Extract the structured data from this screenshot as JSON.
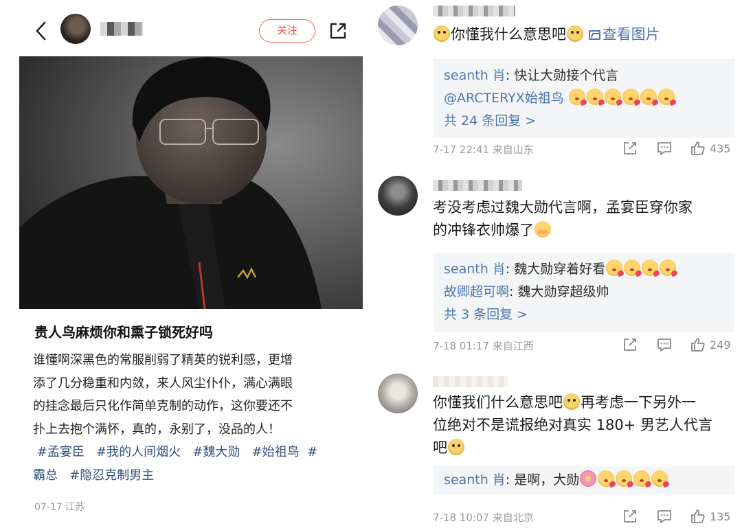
{
  "post": {
    "follow_label": "关注",
    "title": "贵人鸟麻烦你和熏子锁死好吗",
    "body_lines": [
      "谁懂啊深黑色的常服削弱了精英的锐利感，更增",
      "添了几分稳重和内敛，来人风尘仆仆，满心满眼",
      "的挂念最后只化作简单克制的动作，这你要还不",
      "扑上去抱个满怀，真的，永别了，没品的人！"
    ],
    "tags": [
      "#孟宴臣",
      "#我的人间烟火",
      "#魏大勋",
      "#始祖鸟",
      "#霸总",
      "#隐忍克制男主"
    ],
    "meta": "07-17 江苏",
    "icons": {
      "back": "chevron-left-icon",
      "share": "share-icon"
    }
  },
  "comments": [
    {
      "text": "你懂我什么意思吧",
      "view_image_label": "查看图片",
      "replies": [
        {
          "name": "seanth 肖",
          "text": ": 快让大勋接个代言",
          "extra": "@ARCTERYX始祖鸟"
        }
      ],
      "more_label": "共 24 条回复 >",
      "time_location": "7-17 22:41 来自山东",
      "likes": "435"
    },
    {
      "text_line1": "考没考虑过魏大勋代言啊，孟宴臣穿你家",
      "text_line2": "的冲锋衣帅爆了",
      "replies": [
        {
          "name": "seanth 肖",
          "text": ": 魏大勋穿着好看"
        },
        {
          "name": "故卿超可啊",
          "text": ": 魏大勋穿超级帅"
        }
      ],
      "more_label": "共 3 条回复 >",
      "time_location": "7-18 01:17 来自江西",
      "likes": "249"
    },
    {
      "text_line1a": "你懂我们什么意思吧",
      "text_line1b": "再考虑一下另外一",
      "text_line2": "位绝对不是谎报绝对真实 180+ 男艺人代言",
      "text_line3": "吧",
      "replies": [
        {
          "name": "seanth 肖",
          "text": ": 是啊，大勋"
        }
      ],
      "time_location": "7-18 10:07 来自北京",
      "likes": "135"
    }
  ],
  "icons": {
    "repost": "repost-icon",
    "comment": "comment-icon",
    "like": "thumbs-up-icon"
  }
}
